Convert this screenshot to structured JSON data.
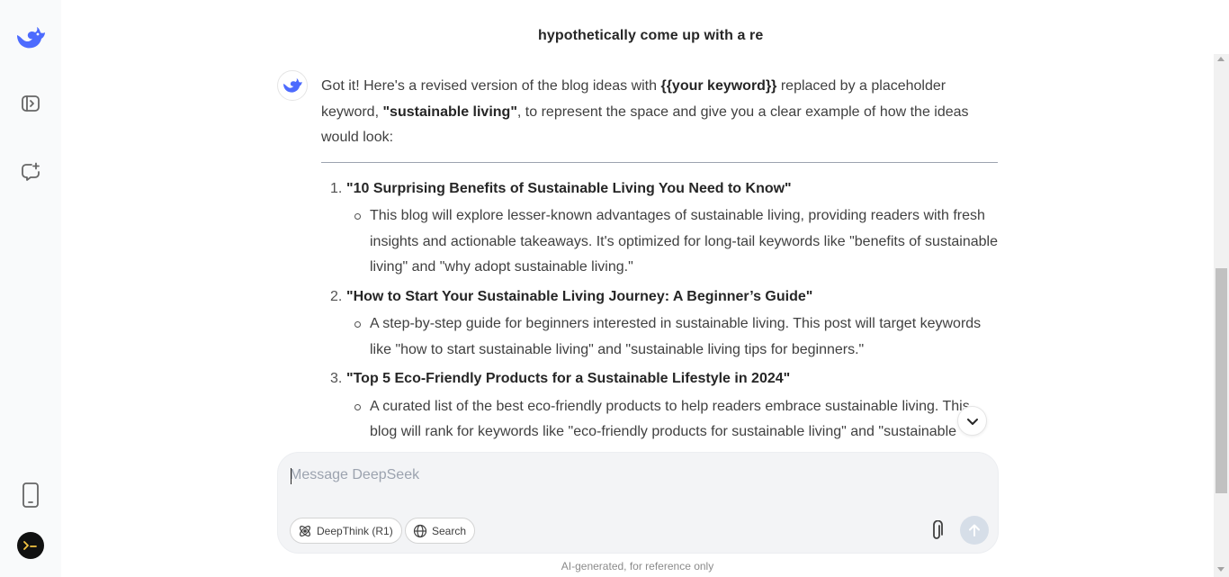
{
  "conversation": {
    "user_message": "hypothetically come up with a re"
  },
  "answer": {
    "intro": [
      {
        "text": "Got it! Here's a revised version of the blog ideas with ",
        "bold": false
      },
      {
        "text": "{{your keyword}}",
        "bold": true
      },
      {
        "text": " replaced by a placeholder keyword, ",
        "bold": false
      },
      {
        "text": "\"sustainable living\"",
        "bold": true
      },
      {
        "text": ", to represent the space and give you a clear example of how the ideas would look:",
        "bold": false
      }
    ],
    "items": [
      {
        "number": "1.",
        "title": "\"10 Surprising Benefits of Sustainable Living You Need to Know\"",
        "sub": "This blog will explore lesser-known advantages of sustainable living, providing readers with fresh insights and actionable takeaways. It's optimized for long-tail keywords like \"benefits of sustainable living\" and \"why adopt sustainable living.\""
      },
      {
        "number": "2.",
        "title": "\"How to Start Your Sustainable Living Journey: A Beginner’s Guide\"",
        "sub": "A step-by-step guide for beginners interested in sustainable living. This post will target keywords like \"how to start sustainable living\" and \"sustainable living tips for beginners.\""
      },
      {
        "number": "3.",
        "title": "\"Top 5 Eco-Friendly Products for a Sustainable Lifestyle in 2024\"",
        "sub": "A curated list of the best eco-friendly products to help readers embrace sustainable living. This blog will rank for keywords like \"eco-friendly products for sustainable living\" and \"sustainable"
      }
    ]
  },
  "composer": {
    "placeholder": "Message DeepSeek",
    "deepthink_label": "DeepThink (R1)",
    "search_label": "Search"
  },
  "footer": {
    "note": "AI-generated, for reference only"
  },
  "icons": {
    "logo": "deepseek-whale-icon",
    "sidebar_toggle": "sidebar-toggle-icon",
    "new_chat": "new-chat-icon",
    "mobile": "mobile-phone-icon",
    "user_avatar": "terminal-avatar-icon",
    "scroll_down": "chevron-down-icon",
    "attach": "paperclip-icon",
    "send": "arrow-up-icon"
  },
  "colors": {
    "brand": "#4d6bfe",
    "send_disabled": "#d6dee8",
    "composer_bg": "#f3f4f6"
  }
}
